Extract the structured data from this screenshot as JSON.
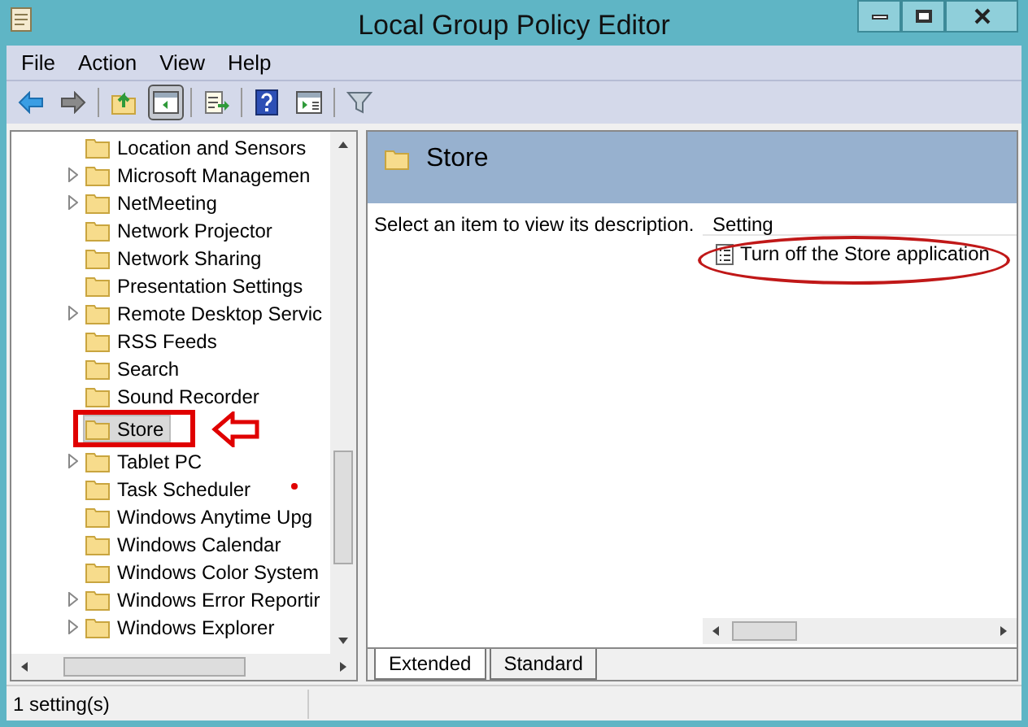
{
  "window": {
    "title": "Local Group Policy Editor"
  },
  "menu": [
    "File",
    "Action",
    "View",
    "Help"
  ],
  "toolbar": [
    {
      "kind": "back",
      "selected": false
    },
    {
      "kind": "forward",
      "selected": false
    },
    {
      "kind": "sep"
    },
    {
      "kind": "up",
      "selected": false
    },
    {
      "kind": "pane",
      "selected": true
    },
    {
      "kind": "sep"
    },
    {
      "kind": "export",
      "selected": false
    },
    {
      "kind": "sep"
    },
    {
      "kind": "help",
      "selected": false
    },
    {
      "kind": "view",
      "selected": false
    },
    {
      "kind": "sep"
    },
    {
      "kind": "filter",
      "selected": false
    }
  ],
  "tree": [
    {
      "label": "Location and Sensors",
      "expandable": false,
      "selected": false
    },
    {
      "label": "Microsoft Managemen",
      "expandable": true,
      "selected": false
    },
    {
      "label": "NetMeeting",
      "expandable": true,
      "selected": false
    },
    {
      "label": "Network Projector",
      "expandable": false,
      "selected": false
    },
    {
      "label": "Network Sharing",
      "expandable": false,
      "selected": false
    },
    {
      "label": "Presentation Settings",
      "expandable": false,
      "selected": false
    },
    {
      "label": "Remote Desktop Servic",
      "expandable": true,
      "selected": false
    },
    {
      "label": "RSS Feeds",
      "expandable": false,
      "selected": false
    },
    {
      "label": "Search",
      "expandable": false,
      "selected": false
    },
    {
      "label": "Sound Recorder",
      "expandable": false,
      "selected": false
    },
    {
      "label": "Store",
      "expandable": false,
      "selected": true
    },
    {
      "label": "Tablet PC",
      "expandable": true,
      "selected": false
    },
    {
      "label": "Task Scheduler",
      "expandable": false,
      "selected": false
    },
    {
      "label": "Windows Anytime Upg",
      "expandable": false,
      "selected": false
    },
    {
      "label": "Windows Calendar",
      "expandable": false,
      "selected": false
    },
    {
      "label": "Windows Color System",
      "expandable": false,
      "selected": false
    },
    {
      "label": "Windows Error Reportir",
      "expandable": true,
      "selected": false
    },
    {
      "label": "Windows Explorer",
      "expandable": true,
      "selected": false
    }
  ],
  "details": {
    "title": "Store",
    "description": "Select an item to view its description.",
    "column": "Setting",
    "settings": [
      "Turn off the Store application"
    ]
  },
  "tabs": [
    {
      "label": "Extended",
      "selected": true
    },
    {
      "label": "Standard",
      "selected": false
    }
  ],
  "status_bar": "1 setting(s)"
}
